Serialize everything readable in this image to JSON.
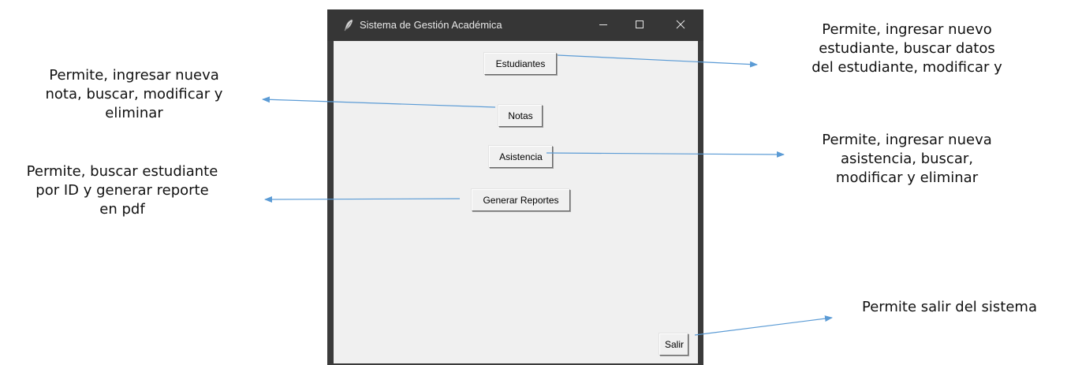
{
  "window": {
    "title": "Sistema de Gestión Académica",
    "icon": "feather-icon",
    "controls": {
      "minimize": "minimize-icon",
      "maximize": "maximize-icon",
      "close": "close-icon"
    }
  },
  "buttons": {
    "estudiantes": "Estudiantes",
    "notas": "Notas",
    "asistencia": "Asistencia",
    "reportes": "Generar Reportes",
    "salir": "Salir"
  },
  "annotations": {
    "estudiantes": [
      "Permite, ingresar nuevo",
      "estudiante, buscar datos",
      "del estudiante, modificar y"
    ],
    "notas": [
      "Permite, ingresar nueva",
      "nota, buscar, modificar y",
      "eliminar"
    ],
    "asistencia": [
      "Permite, ingresar nueva",
      "asistencia, buscar,",
      "modificar y eliminar"
    ],
    "reportes": [
      "Permite, buscar estudiante",
      "por ID y generar reporte",
      "en pdf"
    ],
    "salir": [
      "Permite salir del sistema"
    ]
  },
  "colors": {
    "arrow": "#5b9bd5",
    "titlebar": "#363636",
    "client": "#f0f0f0"
  }
}
